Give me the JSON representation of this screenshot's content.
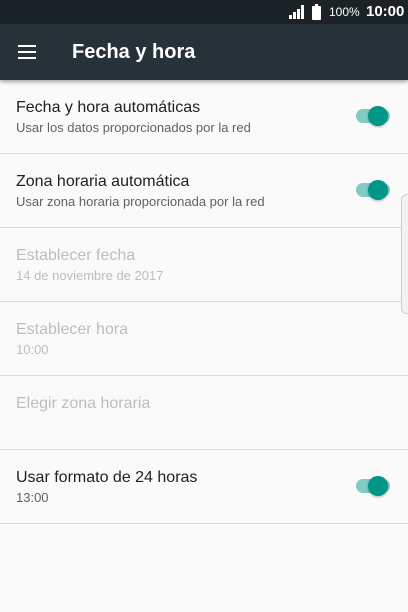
{
  "status_bar": {
    "signal_icon": "signal-icon",
    "battery_icon": "battery-icon",
    "battery": "100%",
    "time": "10:00"
  },
  "app_bar": {
    "menu_icon": "hamburger-menu-icon",
    "title": "Fecha y hora"
  },
  "colors": {
    "app_bar": "#263238",
    "status_bar": "#1c2326",
    "accent": "#009688",
    "accent_track": "#80cbc4"
  },
  "settings": [
    {
      "title": "Fecha y hora automáticas",
      "summary": "Usar los datos proporcionados por la red",
      "enabled": true,
      "toggle": true,
      "checked": true
    },
    {
      "title": "Zona horaria automática",
      "summary": "Usar zona horaria proporcionada por la red",
      "enabled": true,
      "toggle": true,
      "checked": true
    },
    {
      "title": "Establecer fecha",
      "summary": "14 de noviembre de 2017",
      "enabled": false
    },
    {
      "title": "Establecer hora",
      "summary": "10:00",
      "enabled": false
    },
    {
      "title": "Elegir zona horaria",
      "summary": "",
      "enabled": false
    },
    {
      "title": "Usar formato de 24 horas",
      "summary": "13:00",
      "enabled": true,
      "toggle": true,
      "checked": true
    }
  ]
}
